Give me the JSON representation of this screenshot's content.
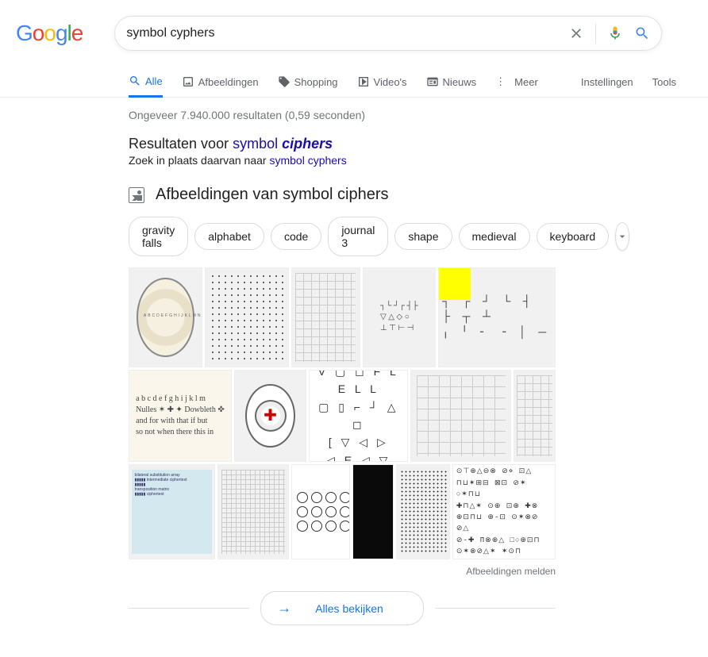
{
  "search": {
    "query": "symbol cyphers"
  },
  "tabs": {
    "all": "Alle",
    "images": "Afbeeldingen",
    "shopping": "Shopping",
    "videos": "Video's",
    "news": "Nieuws",
    "more": "Meer",
    "settings": "Instellingen",
    "tools": "Tools"
  },
  "stats": "Ongeveer 7.940.000 resultaten (0,59 seconden)",
  "spelling": {
    "prefix": "Resultaten voor ",
    "corrected_plain": "symbol ",
    "corrected_em": "ciphers",
    "sub_prefix": "Zoek in plaats daarvan naar ",
    "original": "symbol cyphers"
  },
  "images_block": {
    "title": "Afbeeldingen van symbol ciphers",
    "chips": [
      "gravity falls",
      "alphabet",
      "code",
      "journal 3",
      "shape",
      "medieval",
      "keyboard"
    ],
    "report": "Afbeeldingen melden",
    "view_all": "Alles bekijken"
  }
}
